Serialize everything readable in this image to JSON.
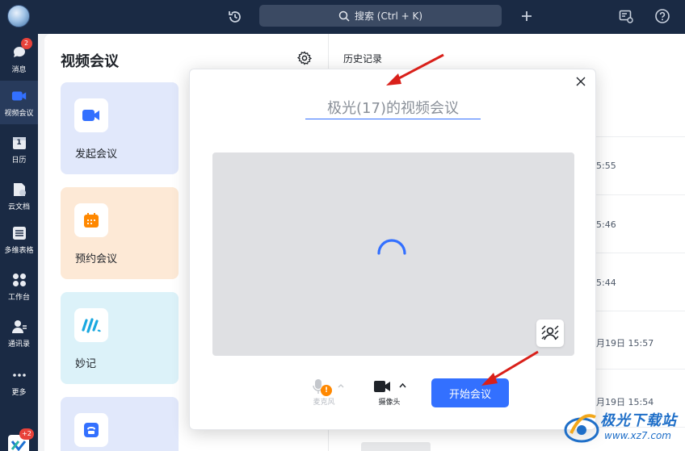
{
  "topbar": {
    "search_placeholder": "搜索 (Ctrl + K)"
  },
  "nav": {
    "items": [
      {
        "label": "消息",
        "badge": "2"
      },
      {
        "label": "视频会议",
        "badge": ""
      },
      {
        "label": "日历",
        "badge": ""
      },
      {
        "label": "云文档",
        "badge": ""
      },
      {
        "label": "多维表格",
        "badge": ""
      },
      {
        "label": "工作台",
        "badge": ""
      },
      {
        "label": "通讯录",
        "badge": ""
      },
      {
        "label": "更多",
        "badge": ""
      }
    ],
    "bottom_badge": "+2"
  },
  "calendar_icon_day": "1",
  "meeting_panel": {
    "title": "视频会议",
    "cards": [
      {
        "label": "发起会议",
        "icon": "video-camera-icon",
        "color": "#e1e8fb"
      },
      {
        "label": "预约会议",
        "icon": "calendar-icon",
        "color": "#fde9d6"
      },
      {
        "label": "妙记",
        "icon": "minutes-icon",
        "color": "#dcf2f9"
      },
      {
        "label": "",
        "icon": "phone-icon",
        "color": "#e1e8fb"
      }
    ]
  },
  "history": {
    "title": "历史记录",
    "times": [
      "5:55",
      "5:46",
      "5:44",
      "月19日 15:57",
      "月19日 15:54"
    ]
  },
  "modal": {
    "meeting_title": "极光(17)的视频会议",
    "mic_label": "麦克风",
    "mic_badge": "!",
    "camera_label": "摄像头",
    "start_label": "开始会议"
  },
  "watermark": {
    "text": "极光下载站",
    "url": "www.xz7.com"
  },
  "colors": {
    "sidebar": "#1a2a44",
    "accent": "#3370ff",
    "arrow": "#d9201a",
    "badge": "#e8423a"
  }
}
